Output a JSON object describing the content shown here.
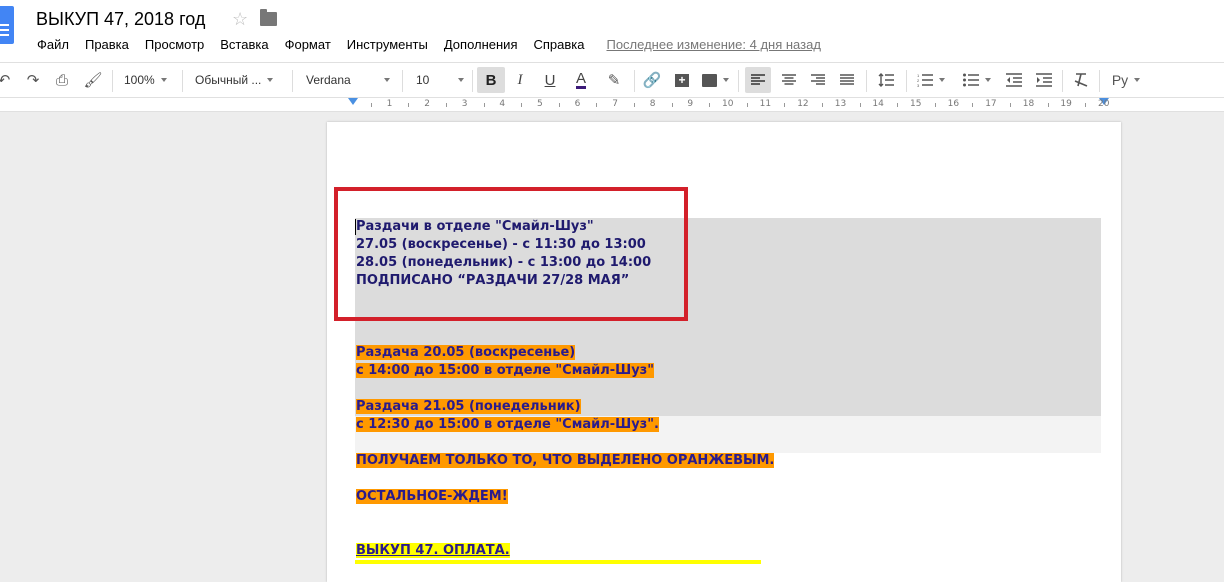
{
  "app": {
    "doc_title": "ВЫКУП 47, 2018 год",
    "star_icon": "star-icon",
    "folder_icon": "folder-icon"
  },
  "menu": {
    "items": [
      "Файл",
      "Правка",
      "Просмотр",
      "Вставка",
      "Формат",
      "Инструменты",
      "Дополнения",
      "Справка"
    ],
    "last_change": "Последнее изменение: 4 дня назад"
  },
  "toolbar": {
    "zoom": "100%",
    "style": "Обычный ...",
    "font": "Verdana",
    "font_size": "10",
    "bold": "B",
    "italic": "I",
    "underline": "U",
    "text_color_letter": "A",
    "input_tools": "Ру",
    "text_color": "#3c1a78"
  },
  "ruler": {
    "numbers": [
      "1",
      "2",
      "3",
      "4",
      "5",
      "6",
      "7",
      "8",
      "9",
      "10",
      "11",
      "12",
      "13",
      "14",
      "15",
      "16",
      "17",
      "18",
      "19",
      "20"
    ]
  },
  "document": {
    "block1": [
      "Раздачи в отделе \"Смайл-Шуз\"",
      "27.05 (воскресенье) - с 11:30 до 13:00",
      "28.05 (понедельник) - с 13:00 до 14:00",
      "ПОДПИСАНО “РАЗДАЧИ 27/28 МАЯ”"
    ],
    "block2": [
      "Раздача 20.05 (воскресенье)",
      "с 14:00 до 15:00 в отделе \"Смайл-Шуз\""
    ],
    "block3": [
      "Раздача 21.05 (понедельник)",
      "с 12:30 до 15:00 в отделе \"Смайл-Шуз\"."
    ],
    "note1": "ПОЛУЧАЕМ ТОЛЬКО ТО, ЧТО ВЫДЕЛЕНО ОРАНЖЕВЫМ.",
    "note2": "ОСТАЛЬНОЕ-ЖДЕМ!",
    "note3": "ВЫКУП 47. ОПЛАТА.",
    "highlight_orange": "#ff9900",
    "highlight_yellow": "#ffff00",
    "annotation_color": "#d3202a"
  }
}
